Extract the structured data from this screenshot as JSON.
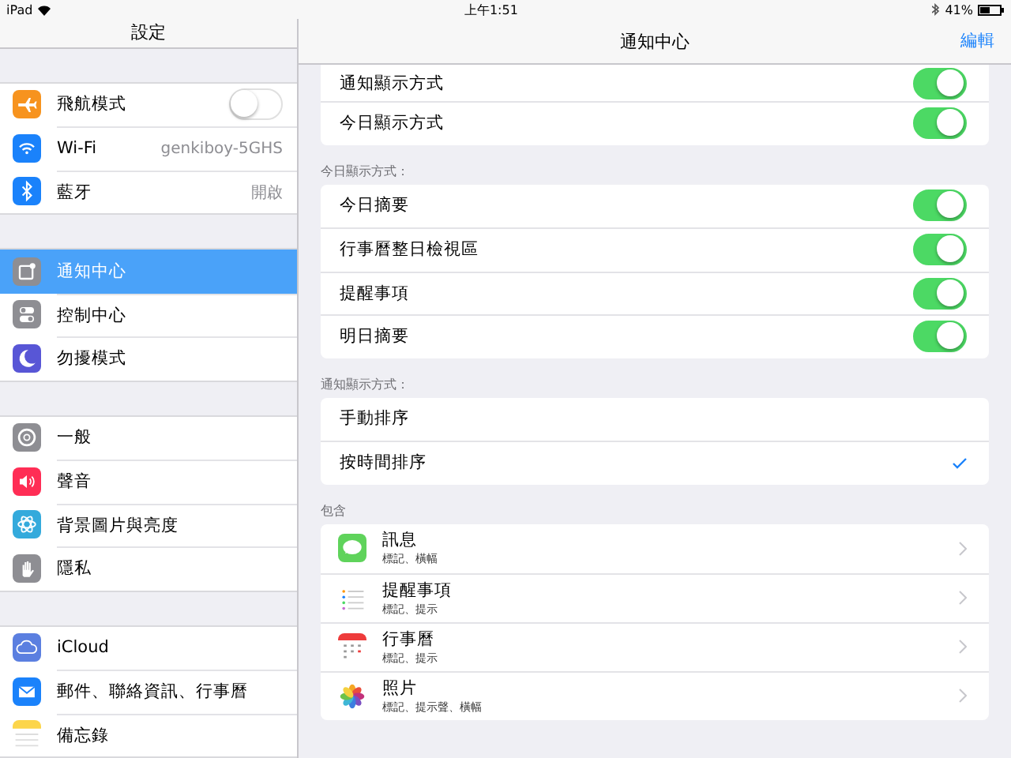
{
  "status_bar": {
    "device": "iPad",
    "time": "上午1:51",
    "battery": "41%"
  },
  "sidebar": {
    "title": "設定",
    "groups": [
      [
        {
          "label": "飛航模式",
          "kind": "toggle",
          "on": false,
          "selected": false
        },
        {
          "label": "Wi-Fi",
          "kind": "value",
          "value": "genkiboy-5GHS",
          "selected": false
        },
        {
          "label": "藍牙",
          "kind": "value",
          "value": "開啟",
          "selected": false
        }
      ],
      [
        {
          "label": "通知中心",
          "kind": "plain",
          "selected": true
        },
        {
          "label": "控制中心",
          "kind": "plain",
          "selected": false
        },
        {
          "label": "勿擾模式",
          "kind": "plain",
          "selected": false
        }
      ],
      [
        {
          "label": "一般",
          "kind": "plain",
          "selected": false
        },
        {
          "label": "聲音",
          "kind": "plain",
          "selected": false
        },
        {
          "label": "背景圖片與亮度",
          "kind": "plain",
          "selected": false
        },
        {
          "label": "隱私",
          "kind": "plain",
          "selected": false
        }
      ],
      [
        {
          "label": "iCloud",
          "kind": "plain",
          "selected": false
        },
        {
          "label": "郵件、聯絡資訊、行事曆",
          "kind": "plain",
          "selected": false
        },
        {
          "label": "備忘錄",
          "kind": "plain",
          "selected": false
        }
      ]
    ]
  },
  "detail": {
    "title": "通知中心",
    "edit_button": "編輯",
    "sections": [
      {
        "rows": [
          {
            "kind": "toggle",
            "label": "通知顯示方式",
            "on": true
          },
          {
            "kind": "toggle",
            "label": "今日顯示方式",
            "on": true
          }
        ]
      },
      {
        "header": "今日顯示方式：",
        "rows": [
          {
            "kind": "toggle",
            "label": "今日摘要",
            "on": true
          },
          {
            "kind": "toggle",
            "label": "行事曆整日檢視區",
            "on": true
          },
          {
            "kind": "toggle",
            "label": "提醒事項",
            "on": true
          },
          {
            "kind": "toggle",
            "label": "明日摘要",
            "on": true
          }
        ]
      },
      {
        "header": "通知顯示方式：",
        "rows": [
          {
            "kind": "option",
            "label": "手動排序",
            "selected": false
          },
          {
            "kind": "option",
            "label": "按時間排序",
            "selected": true
          }
        ]
      },
      {
        "header": "包含",
        "rows": [
          {
            "kind": "app",
            "label": "訊息",
            "subtitle": "標記、橫幅"
          },
          {
            "kind": "app",
            "label": "提醒事項",
            "subtitle": "標記、提示"
          },
          {
            "kind": "app",
            "label": "行事曆",
            "subtitle": "標記、提示"
          },
          {
            "kind": "app",
            "label": "照片",
            "subtitle": "標記、提示聲、橫幅"
          }
        ]
      }
    ]
  }
}
